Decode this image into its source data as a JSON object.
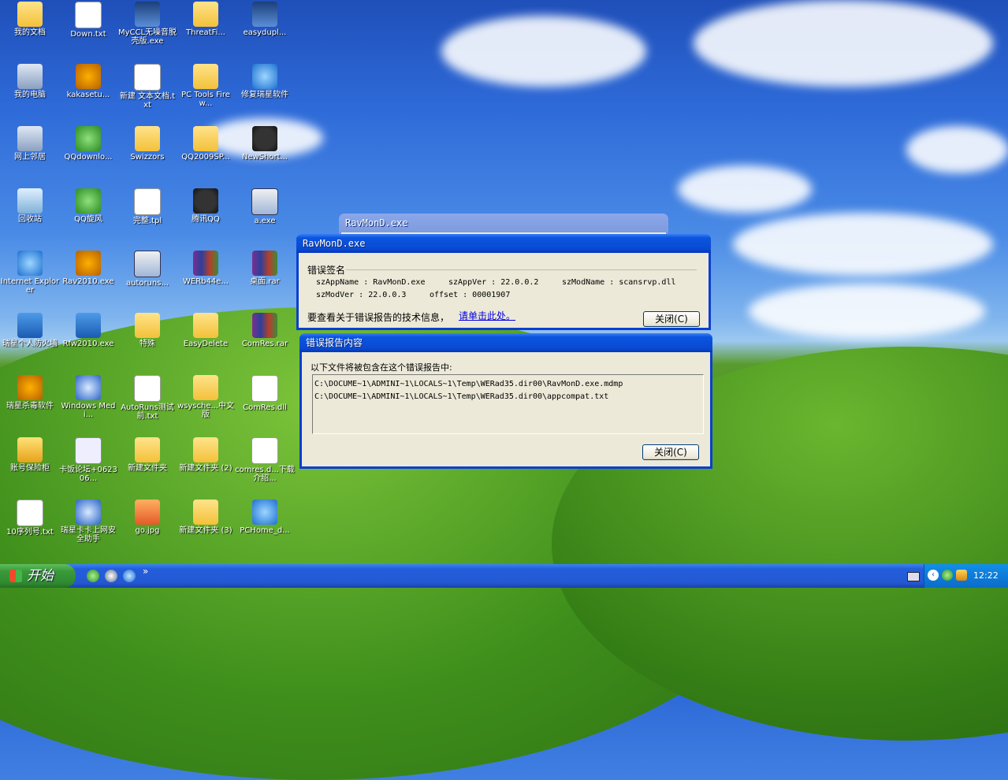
{
  "desktop_icons": [
    {
      "label": "我的文档",
      "icon": "my-documents-icon"
    },
    {
      "label": "Down.txt",
      "icon": "text-file-icon"
    },
    {
      "label": "MyCCL无噪音脱壳版.exe",
      "icon": "myccl-app-icon"
    },
    {
      "label": "ThreatFi...",
      "icon": "threatfire-icon"
    },
    {
      "label": "easydupl...",
      "icon": "easyduplicate-icon"
    },
    {
      "label": "我的电脑",
      "icon": "my-computer-icon"
    },
    {
      "label": "kakasetu...",
      "icon": "rising-lion-icon"
    },
    {
      "label": "新建 文本文档.txt",
      "icon": "text-file-icon"
    },
    {
      "label": "PC Tools Firew...",
      "icon": "pctools-firewall-icon"
    },
    {
      "label": "修复瑞星软件",
      "icon": "ie-repair-icon"
    },
    {
      "label": "网上邻居",
      "icon": "network-places-icon"
    },
    {
      "label": "QQdownlo...",
      "icon": "qq-download-icon"
    },
    {
      "label": "Swizzors",
      "icon": "folder-icon"
    },
    {
      "label": "QQ2009SP...",
      "icon": "qq-installer-icon"
    },
    {
      "label": "NewShort...",
      "icon": "qq-penguin-icon"
    },
    {
      "label": "回收站",
      "icon": "recycle-bin-icon"
    },
    {
      "label": "QQ旋风",
      "icon": "qq-whirlwind-icon"
    },
    {
      "label": "完整.tpl",
      "icon": "template-file-icon"
    },
    {
      "label": "腾讯QQ",
      "icon": "qq-penguin-icon"
    },
    {
      "label": "a.exe",
      "icon": "console-app-icon"
    },
    {
      "label": "Internet Explorer",
      "icon": "internet-explorer-icon"
    },
    {
      "label": "Rav2010.exe",
      "icon": "rising-lion-icon"
    },
    {
      "label": "autoruns...",
      "icon": "autoruns-icon"
    },
    {
      "label": "WERb44e...",
      "icon": "winrar-archive-icon"
    },
    {
      "label": "桌面.rar",
      "icon": "winrar-archive-icon"
    },
    {
      "label": "瑞星个人防火墙",
      "icon": "rising-firewall-icon"
    },
    {
      "label": "Rfw2010.exe",
      "icon": "rising-firewall-icon"
    },
    {
      "label": "特殊",
      "icon": "folder-icon"
    },
    {
      "label": "EasyDelete",
      "icon": "folder-icon"
    },
    {
      "label": "ComRes.rar",
      "icon": "winrar-archive-icon"
    },
    {
      "label": "瑞星杀毒软件",
      "icon": "rising-lion-icon"
    },
    {
      "label": "Windows Medi...",
      "icon": "windows-media-player-icon"
    },
    {
      "label": "AutoRuns测试前.txt",
      "icon": "text-file-icon"
    },
    {
      "label": "wsysche...中文版",
      "icon": "folder-icon"
    },
    {
      "label": "ComRes.dll",
      "icon": "dll-file-icon"
    },
    {
      "label": "账号保险柜",
      "icon": "account-safe-icon"
    },
    {
      "label": "卡饭论坛+0623 06...",
      "icon": "zip-archive-icon"
    },
    {
      "label": "新建文件夹",
      "icon": "folder-icon"
    },
    {
      "label": "新建文件夹 (2)",
      "icon": "folder-icon"
    },
    {
      "label": "comres.d...下载介绍...",
      "icon": "text-file-icon"
    },
    {
      "label": "10序列号.txt",
      "icon": "text-file-icon"
    },
    {
      "label": "瑞星卡卡上网安全助手",
      "icon": "kaka-assistant-icon"
    },
    {
      "label": "go.jpg",
      "icon": "image-file-icon"
    },
    {
      "label": "新建文件夹 (3)",
      "icon": "folder-icon"
    },
    {
      "label": "PCHome_d...",
      "icon": "internet-explorer-icon"
    }
  ],
  "background_window": {
    "title": "RavMonD.exe"
  },
  "error_window": {
    "title": "RavMonD.exe",
    "section_label": "错误签名",
    "app_name": "szAppName : RavMonD.exe",
    "app_ver": "szAppVer : 22.0.0.2",
    "mod_name": "szModName : scansrvp.dll",
    "mod_ver": "szModVer : 22.0.0.3",
    "offset": "offset : 00001907",
    "info_text": "要查看关于错误报告的技术信息，",
    "link_text": "请单击此处。",
    "close_label": "关闭(C)"
  },
  "report_window": {
    "title": "错误报告内容",
    "intro": "以下文件将被包含在这个错误报告中:",
    "files": [
      "C:\\DOCUME~1\\ADMINI~1\\LOCALS~1\\Temp\\WERad35.dir00\\RavMonD.exe.mdmp",
      "C:\\DOCUME~1\\ADMINI~1\\LOCALS~1\\Temp\\WERad35.dir00\\appcompat.txt"
    ],
    "close_label": "关闭(C)"
  },
  "taskbar": {
    "start_label": "开始",
    "quick_launch": [
      "quick-launch-green-icon",
      "media-player-icon",
      "ie-icon"
    ],
    "overflow_label": "»",
    "clock": "12:22"
  }
}
